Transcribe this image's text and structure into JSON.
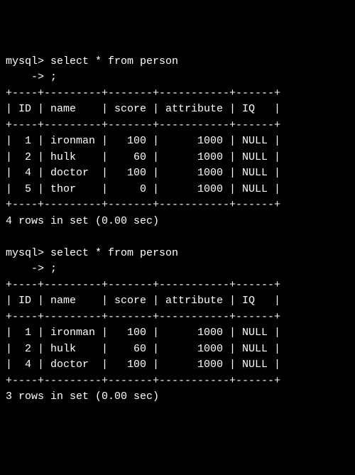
{
  "prompts": {
    "mysql": "mysql>",
    "cont": "    ->"
  },
  "queries": [
    {
      "command": "select * from person",
      "terminator": ";",
      "sep": "+----+---------+-------+-----------+------+",
      "header_cells": [
        "ID",
        "name",
        "score",
        "attribute",
        "IQ"
      ],
      "header_line": "| ID | name    | score | attribute | IQ   |",
      "rows": [
        {
          "ID": 1,
          "name": "ironman",
          "score": 100,
          "attribute": 1000,
          "IQ": "NULL",
          "line": "|  1 | ironman |   100 |      1000 | NULL |"
        },
        {
          "ID": 2,
          "name": "hulk",
          "score": 60,
          "attribute": 1000,
          "IQ": "NULL",
          "line": "|  2 | hulk    |    60 |      1000 | NULL |"
        },
        {
          "ID": 4,
          "name": "doctor",
          "score": 100,
          "attribute": 1000,
          "IQ": "NULL",
          "line": "|  4 | doctor  |   100 |      1000 | NULL |"
        },
        {
          "ID": 5,
          "name": "thor",
          "score": 0,
          "attribute": 1000,
          "IQ": "NULL",
          "line": "|  5 | thor    |     0 |      1000 | NULL |"
        }
      ],
      "status": "4 rows in set (0.00 sec)"
    },
    {
      "command": "select * from person",
      "terminator": ";",
      "sep": "+----+---------+-------+-----------+------+",
      "header_cells": [
        "ID",
        "name",
        "score",
        "attribute",
        "IQ"
      ],
      "header_line": "| ID | name    | score | attribute | IQ   |",
      "rows": [
        {
          "ID": 1,
          "name": "ironman",
          "score": 100,
          "attribute": 1000,
          "IQ": "NULL",
          "line": "|  1 | ironman |   100 |      1000 | NULL |"
        },
        {
          "ID": 2,
          "name": "hulk",
          "score": 60,
          "attribute": 1000,
          "IQ": "NULL",
          "line": "|  2 | hulk    |    60 |      1000 | NULL |"
        },
        {
          "ID": 4,
          "name": "doctor",
          "score": 100,
          "attribute": 1000,
          "IQ": "NULL",
          "line": "|  4 | doctor  |   100 |      1000 | NULL |"
        }
      ],
      "status": "3 rows in set (0.00 sec)"
    }
  ]
}
